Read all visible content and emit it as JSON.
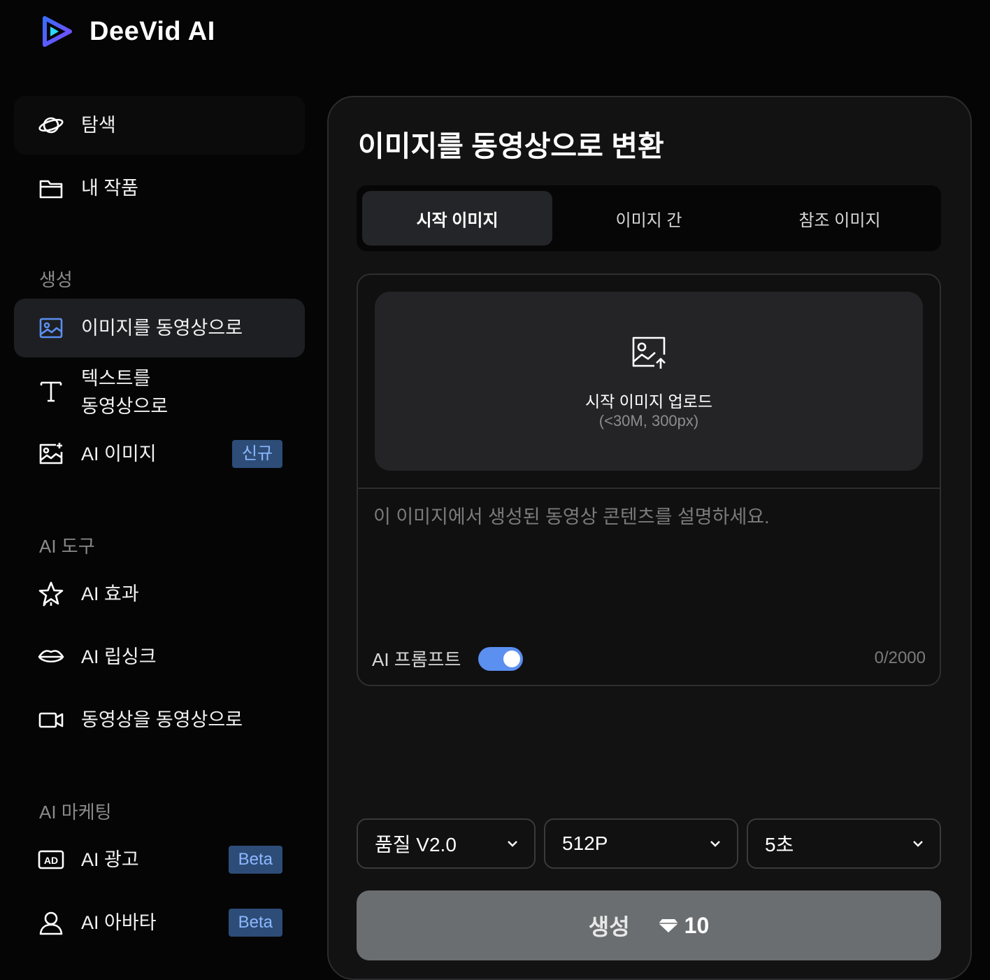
{
  "brand": {
    "name": "DeeVid AI",
    "accent": "#4f8cff"
  },
  "sidebar": {
    "top": [
      {
        "label": "탐색",
        "icon": "planet-icon"
      },
      {
        "label": "내 작품",
        "icon": "folder-icon"
      }
    ],
    "sections": [
      {
        "title": "생성",
        "items": [
          {
            "label": "이미지를 동영상으로",
            "icon": "image-icon",
            "active": true
          },
          {
            "label": "텍스트를 동영상으로",
            "line1": "텍스트를",
            "line2": "동영상으로",
            "icon": "text-icon"
          },
          {
            "label": "AI 이미지",
            "icon": "ai-image-icon",
            "badge": "신규"
          }
        ]
      },
      {
        "title": "AI 도구",
        "items": [
          {
            "label": "AI 효과",
            "icon": "star-icon"
          },
          {
            "label": "AI 립싱크",
            "icon": "lips-icon"
          },
          {
            "label": "동영상을 동영상으로",
            "icon": "video-camera-icon"
          }
        ]
      },
      {
        "title": "AI 마케팅",
        "items": [
          {
            "label": "AI 광고",
            "icon": "ad-icon",
            "badge": "Beta"
          },
          {
            "label": "AI 아바타",
            "icon": "avatar-icon",
            "badge": "Beta"
          }
        ]
      }
    ]
  },
  "main": {
    "title": "이미지를 동영상으로 변환",
    "tabs": [
      {
        "label": "시작 이미지",
        "active": true
      },
      {
        "label": "이미지 간"
      },
      {
        "label": "참조 이미지"
      }
    ],
    "upload": {
      "title": "시작 이미지 업로드",
      "hint": "(<30M, 300px)"
    },
    "prompt": {
      "placeholder": "이 이미지에서 생성된 동영상 콘텐츠를 설명하세요.",
      "value": ""
    },
    "ai_prompt": {
      "label": "AI 프롬프트",
      "enabled": true
    },
    "counter": "0/2000",
    "selects": [
      {
        "value": "품질 V2.0"
      },
      {
        "value": "512P"
      },
      {
        "value": "5초"
      }
    ],
    "generate": {
      "label": "생성",
      "cost": "10"
    }
  }
}
